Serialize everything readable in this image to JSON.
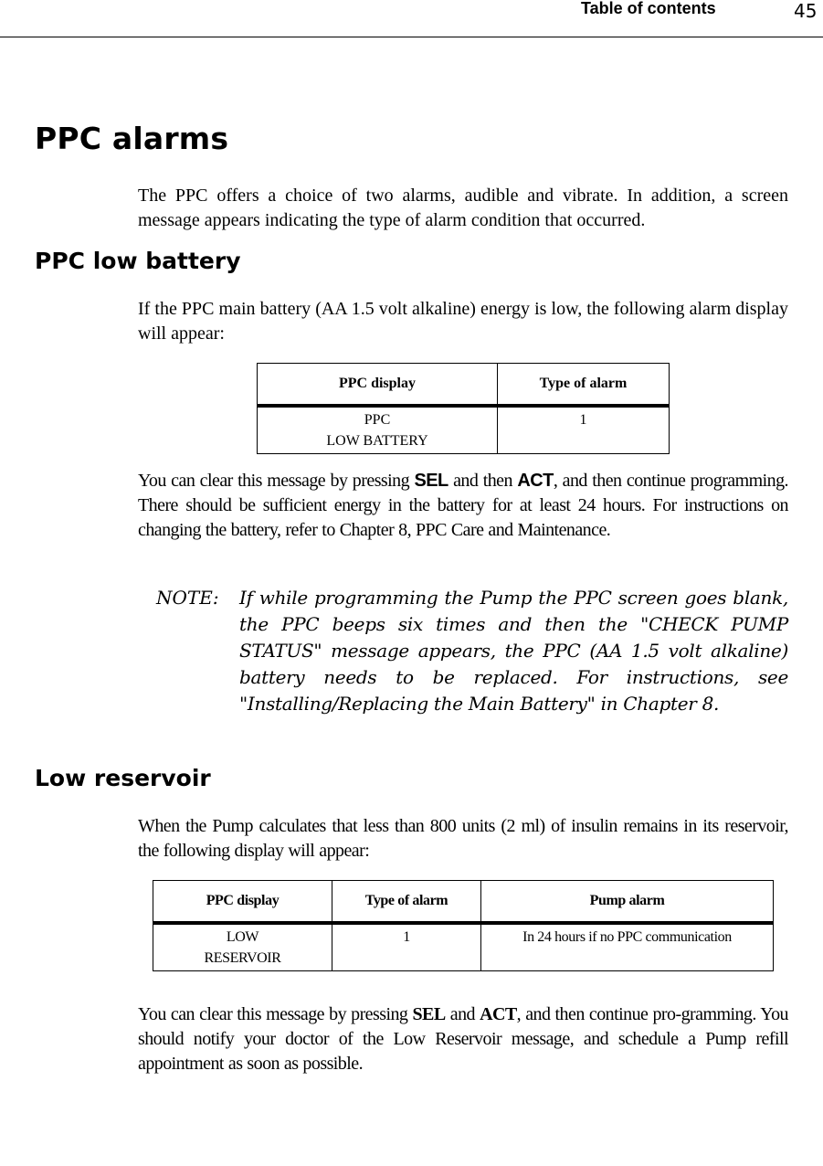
{
  "header": {
    "section_title": "Table of contents",
    "page_number": "45"
  },
  "sections": {
    "ppc_alarms": {
      "heading": "PPC alarms",
      "intro": "The PPC offers a choice of two alarms, audible and vibrate. In addition, a screen message appears indicating the type of alarm condition that occurred."
    },
    "ppc_low_battery": {
      "heading": "PPC low battery",
      "intro": "If the PPC main battery (AA 1.5 volt alkaline) energy is low, the following alarm display will appear:",
      "table": {
        "columns": [
          "PPC display",
          "Type of alarm"
        ],
        "rows": [
          {
            "ppc_display_line1": "PPC",
            "ppc_display_line2": "LOW BATTERY",
            "type_of_alarm": "1"
          }
        ]
      },
      "clear_text": {
        "part1": "You can clear this message by pressing ",
        "key1": "SEL",
        "part2": " and then ",
        "key2": "ACT",
        "part3": ", and then continue programming. There should be sufficient energy in the battery for at least 24 hours. For instructions on changing the battery, refer to Chapter 8, PPC Care and Maintenance."
      },
      "note": {
        "label": "NOTE:",
        "text": "If while programming the Pump the PPC screen goes blank, the PPC beeps six times and then the \"CHECK PUMP STATUS\" message appears, the PPC (AA 1.5 volt alkaline) battery needs to be replaced. For instructions, see \"Installing/Replacing the Main Battery\" in Chapter 8."
      }
    },
    "low_reservoir": {
      "heading": "Low reservoir",
      "intro": "When the Pump calculates that less than 800 units (2 ml) of insulin remains in its reservoir, the following display will appear:",
      "table": {
        "columns": [
          "PPC display",
          "Type of alarm",
          "Pump alarm"
        ],
        "rows": [
          {
            "ppc_display_line1": "LOW",
            "ppc_display_line2": "RESERVOIR",
            "type_of_alarm": "1",
            "pump_alarm": "In 24 hours if no PPC communication"
          }
        ]
      },
      "clear_text": {
        "part1": "You can clear this message by pressing ",
        "key1": "SEL",
        "part2": " and ",
        "key2": "ACT",
        "part3": ", and then continue pro-gramming. You should notify your doctor of the Low Reservoir message, and schedule a Pump refill appointment as soon as possible."
      }
    }
  }
}
